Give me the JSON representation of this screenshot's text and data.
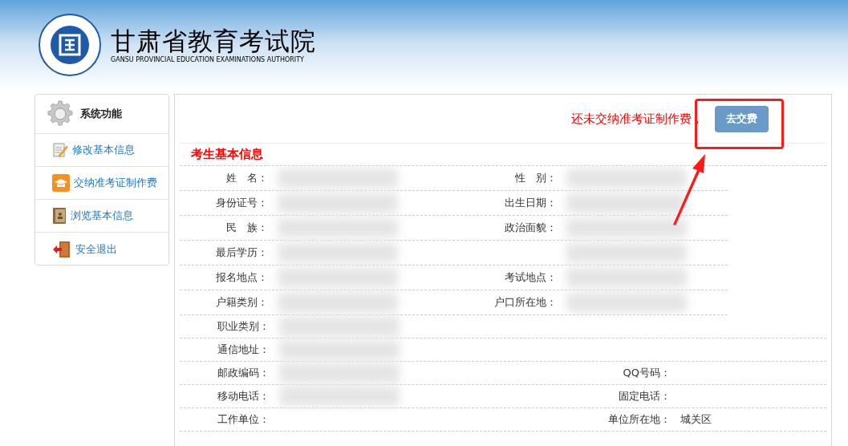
{
  "header": {
    "title": "甘肃省教育考试院",
    "subtitle": "GANSU PROVINCIAL EDUCATION EXAMINATIONS AUTHORITY"
  },
  "sidebar": {
    "heading": "系统功能",
    "items": [
      {
        "label": "修改基本信息",
        "kind": "edit"
      },
      {
        "label": "交纳准考证制作费",
        "kind": "pay"
      },
      {
        "label": "浏览基本信息",
        "kind": "book"
      },
      {
        "label": "安全退出",
        "kind": "exit"
      }
    ]
  },
  "notice": {
    "text": "还未交纳准考证制作费，",
    "button": "去交费"
  },
  "section_title": "考生基本信息",
  "rows": [
    {
      "kind": "pair",
      "left": {
        "label": "姓　名：",
        "redacted": true
      },
      "right": {
        "label": "性　别：",
        "redacted": true
      }
    },
    {
      "kind": "pair",
      "left": {
        "label": "身份证号：",
        "redacted": true
      },
      "right": {
        "label": "出生日期：",
        "redacted": true
      }
    },
    {
      "kind": "pair",
      "left": {
        "label": "民　族：",
        "redacted": true
      },
      "right": {
        "label": "政治面貌：",
        "redacted": true
      }
    },
    {
      "kind": "pair",
      "left": {
        "label": "最后学历：",
        "redacted": true
      },
      "right": {
        "redacted": true
      }
    },
    {
      "kind": "pair",
      "left": {
        "label": "报名地点：",
        "redacted": true
      },
      "right": {
        "label": "考试地点：",
        "redacted": true
      }
    },
    {
      "kind": "pair",
      "left": {
        "label": "户籍类别：",
        "redacted": true
      },
      "right": {
        "label": "户口所在地：",
        "redacted": true
      }
    },
    {
      "kind": "wide",
      "left": {
        "label": "职业类别：",
        "redacted": true
      }
    },
    {
      "kind": "wide",
      "left": {
        "label": "通信地址：",
        "redacted": true
      }
    },
    {
      "kind": "wide",
      "left": {
        "label": "邮政编码：",
        "redacted": true
      },
      "right": {
        "label": "QQ号码："
      }
    },
    {
      "kind": "wide",
      "left": {
        "label": "移动电话：",
        "redacted": true
      },
      "right": {
        "label": "固定电话："
      }
    },
    {
      "kind": "wide",
      "left": {
        "label": "工作单位："
      },
      "right": {
        "label": "单位所在地：",
        "value": "城关区"
      }
    }
  ]
}
